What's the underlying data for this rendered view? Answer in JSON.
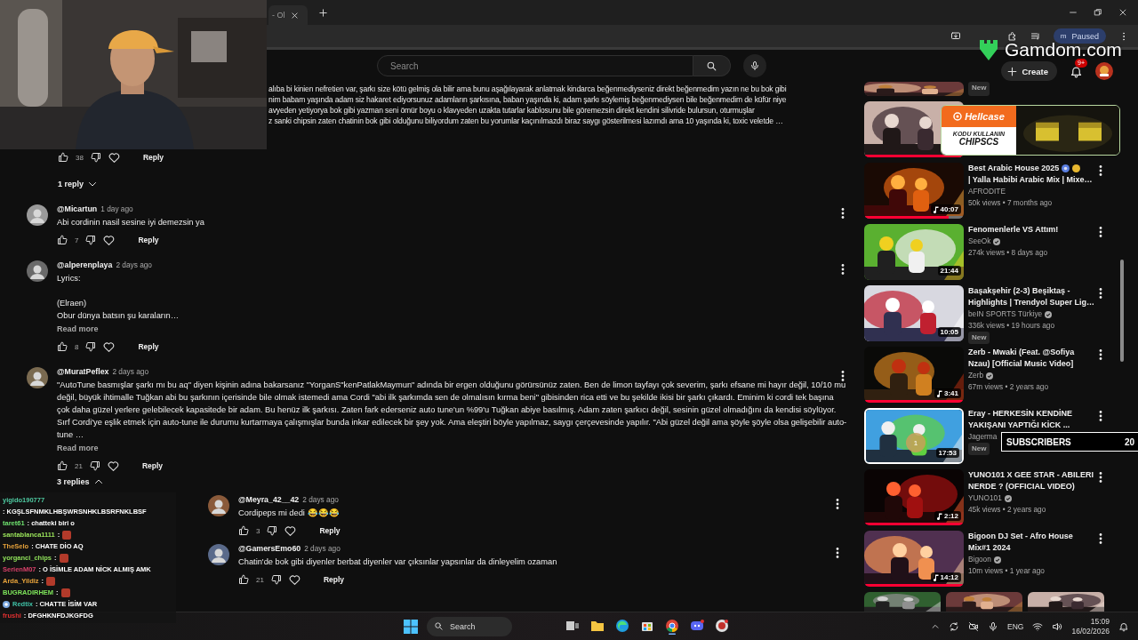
{
  "browser": {
    "tab_title": "- Ol",
    "profile_initial": "m",
    "profile_status": "Paused"
  },
  "stream_overlay": {
    "sponsor": "Gamdom.com",
    "ad": {
      "brand": "Hellcase",
      "line1": "KODU KULLANIN",
      "line2": "CHIPSCS"
    },
    "alert": {
      "badge": "1",
      "label": "SUBSCRIBERS",
      "count": "20"
    },
    "chat": [
      {
        "user": "yigido190777",
        "color": "#4ec9a0",
        "message": ": KGŞLSFNMKLHBŞWRSNHKLBSRFNKLBSF",
        "emote": false,
        "badge": false
      },
      {
        "user": "taret61",
        "color": "#6ee06e",
        "message": ": chatteki biri o",
        "emote": false,
        "badge": false
      },
      {
        "user": "santablanca1111",
        "color": "#9ae35a",
        "message": ":",
        "emote": true,
        "badge": false
      },
      {
        "user": "TheSelo",
        "color": "#e8a33b",
        "message": ": CHATE DİO AQ",
        "emote": false,
        "badge": false
      },
      {
        "user": "yorganci_chips",
        "color": "#8fe05a",
        "message": ":",
        "emote": true,
        "badge": false
      },
      {
        "user": "SerienM07",
        "color": "#d9406a",
        "message": ": O İSİMLE ADAM NİCK ALMIŞ AMK",
        "emote": false,
        "badge": false
      },
      {
        "user": "Arda_Yildiz",
        "color": "#e8a33b",
        "message": ":",
        "emote": true,
        "badge": false
      },
      {
        "user": "BUGRADIRHEM",
        "color": "#7de35a",
        "message": ":",
        "emote": true,
        "badge": false
      },
      {
        "user": "Redtix",
        "color": "#3fc1a6",
        "message": ": CHATTE İSİM VAR",
        "emote": false,
        "badge": true
      },
      {
        "user": "frushi",
        "color": "#e03030",
        "message": ": DFGHKNFDJKGFDG",
        "emote": false,
        "badge": false
      }
    ]
  },
  "header": {
    "search_placeholder": "Search",
    "create": "Create",
    "notifications": "9+"
  },
  "comments": {
    "cut_comment": {
      "lines": [
        "alıba bi kinien nefretien var, şarkı size kötü gelmiş ola bilir ama bunu aşağılayarak anlatmak kindarca beğenmediyseniz direkt beğenmedim yazın ne bu bok gibi",
        "nim babam yaşında adam siz hakaret ediyorsunuz adamların şarkısına, baban yaşında ki, adam şarkı söylemiş beğenmediysen bile beğenmedim de küfür niye",
        "avyeden yetiyorya bok gibi yazman seni ömür boyu o klavyeden uzakta tutarlar kablosunu bile göremezsin direkt kendini silivride bulursun, oturmuşlar",
        "z sanki chipsin zaten chatinin bok gibi olduğunu biliyordum zaten bu yorumlar kaçınılmazdı biraz saygı gösterilmesi lazımdı ama 10 yaşında ki, toxic veletde …"
      ],
      "likes": "38",
      "reply": "Reply",
      "replies_toggle": "1 reply"
    },
    "items": [
      {
        "author": "@Micartun",
        "time": "1 day ago",
        "text": "Abi cordinin nasil sesine iyi demezsin ya",
        "likes": "7",
        "reply": "Reply"
      },
      {
        "author": "@alperenplaya",
        "time": "2 days ago",
        "text": "Lyrics:\n\n(Elraen)\nObur dünya batsın şu karaların…",
        "read_more": "Read more",
        "likes": "8",
        "reply": "Reply"
      },
      {
        "author": "@MuratPeflex",
        "time": "2 days ago",
        "text": "\"AutoTune basmışlar şarkı mı bu aq\" diyen kişinin adına bakarsanız \"YorganS\"kenPatlakMaymun\" adında bir ergen olduğunu görürsünüz zaten. Ben de limon tayfayı çok severim, şarkı efsane mi hayır değil, 10/10 mu değil, büyük ihtimalle Tuğkan abi bu şarkının içerisinde bile olmak istemedi ama Cordi \"abi ilk şarkımda sen de olmalısın kırma beni\" gibisinden rica etti ve bu şekilde ikisi bir şarkı çıkardı. Eminim ki cordi tek başına çok daha güzel yerlere gelebilecek kapasitede bir adam. Bu henüz ilk şarkısı. Zaten fark ederseniz auto tune'un %99'u Tuğkan abiye basılmış. Adam zaten şarkıcı değil, sesinin güzel olmadığını da kendisi söylüyor. Sırf Cordi'ye eşlik etmek için auto-tune ile durumu kurtarmaya çalışmışlar bunda inkar edilecek bir şey yok. Ama eleştiri böyle yapılmaz, saygı çerçevesinde yapılır. \"Abi güzel değil ama şöyle şöyle olsa gelişebilir auto-tune …",
        "read_more": "Read more",
        "likes": "21",
        "reply": "Reply",
        "replies_toggle": "3 replies",
        "expanded": true,
        "replies": [
          {
            "author": "@Meyra_42__42",
            "time": "2 days ago",
            "text": "Cordipeps mi dedi 😂😂😂",
            "likes": "3",
            "reply": "Reply"
          },
          {
            "author": "@GamersEmo60",
            "time": "2 days ago",
            "text": "Chatin'de bok gibi diyenler berbat diyenler var çıksınlar yapsınlar da dinleyelim ozaman",
            "likes": "21",
            "reply": "Reply"
          }
        ]
      }
    ]
  },
  "sidebar": {
    "videos": [
      {
        "kind": "cut",
        "new": "New"
      },
      {
        "kind": "video",
        "level": 1
      },
      {
        "kind": "video",
        "title_lines": [
          "Best Arabic House 2025",
          "| Yalla Habibi Arabic Mix | Mixe…"
        ],
        "emoji_marks": true,
        "channel": "AFRODITE",
        "verified": false,
        "meta": "50k views • 7 months ago",
        "duration": "40:07",
        "music": true,
        "level": 0.85
      },
      {
        "kind": "video",
        "title_lines": [
          "Fenomenlerle VS Attım!"
        ],
        "channel": "SeeOk",
        "verified": true,
        "meta": "274k views • 8 days ago",
        "duration": "21:44",
        "music": false
      },
      {
        "kind": "video",
        "title_lines": [
          "Başakşehir (2-3) Beşiktaş -",
          "Highlights | Trendyol Super Lig…"
        ],
        "channel": "beIN SPORTS Türkiye",
        "verified": true,
        "meta": "336k views • 19 hours ago",
        "new": "New",
        "duration": "10:05",
        "music": false
      },
      {
        "kind": "video",
        "title_lines": [
          "Zerb - Mwaki (Feat. @Sofiya",
          "Nzau) [Official Music Video]"
        ],
        "channel": "Zerb",
        "verified": true,
        "meta": "67m views • 2 years ago",
        "duration": "3:41",
        "music": true,
        "level": 1
      },
      {
        "kind": "video",
        "title_lines": [
          "Eray - HERKESİN KENDİNE",
          "YAKIŞANI YAPTIĞI KİCK ..."
        ],
        "channel": "Jagerma",
        "verified": false,
        "new": "New",
        "duration": "17:53",
        "music": false,
        "highlighted": true
      },
      {
        "kind": "video",
        "title_lines": [
          "YUNO101 X GEE STAR - ABILERI",
          "NERDE ? (OFFICIAL VIDEO)"
        ],
        "channel": "YUNO101",
        "verified": true,
        "meta": "45k views • 2 years ago",
        "duration": "2:12",
        "music": true,
        "level": 1
      },
      {
        "kind": "video",
        "title_lines": [
          "Bigoon DJ Set - Afro House",
          "Mix#1 2024"
        ],
        "channel": "Bigoon",
        "verified": true,
        "meta": "10m views • 1 year ago",
        "duration": "14:12",
        "music": true,
        "level": 1
      },
      {
        "kind": "shorts"
      }
    ]
  },
  "taskbar": {
    "search_placeholder": "Search",
    "language": "ENG",
    "time": "15:09",
    "date": "16/02/2026"
  }
}
